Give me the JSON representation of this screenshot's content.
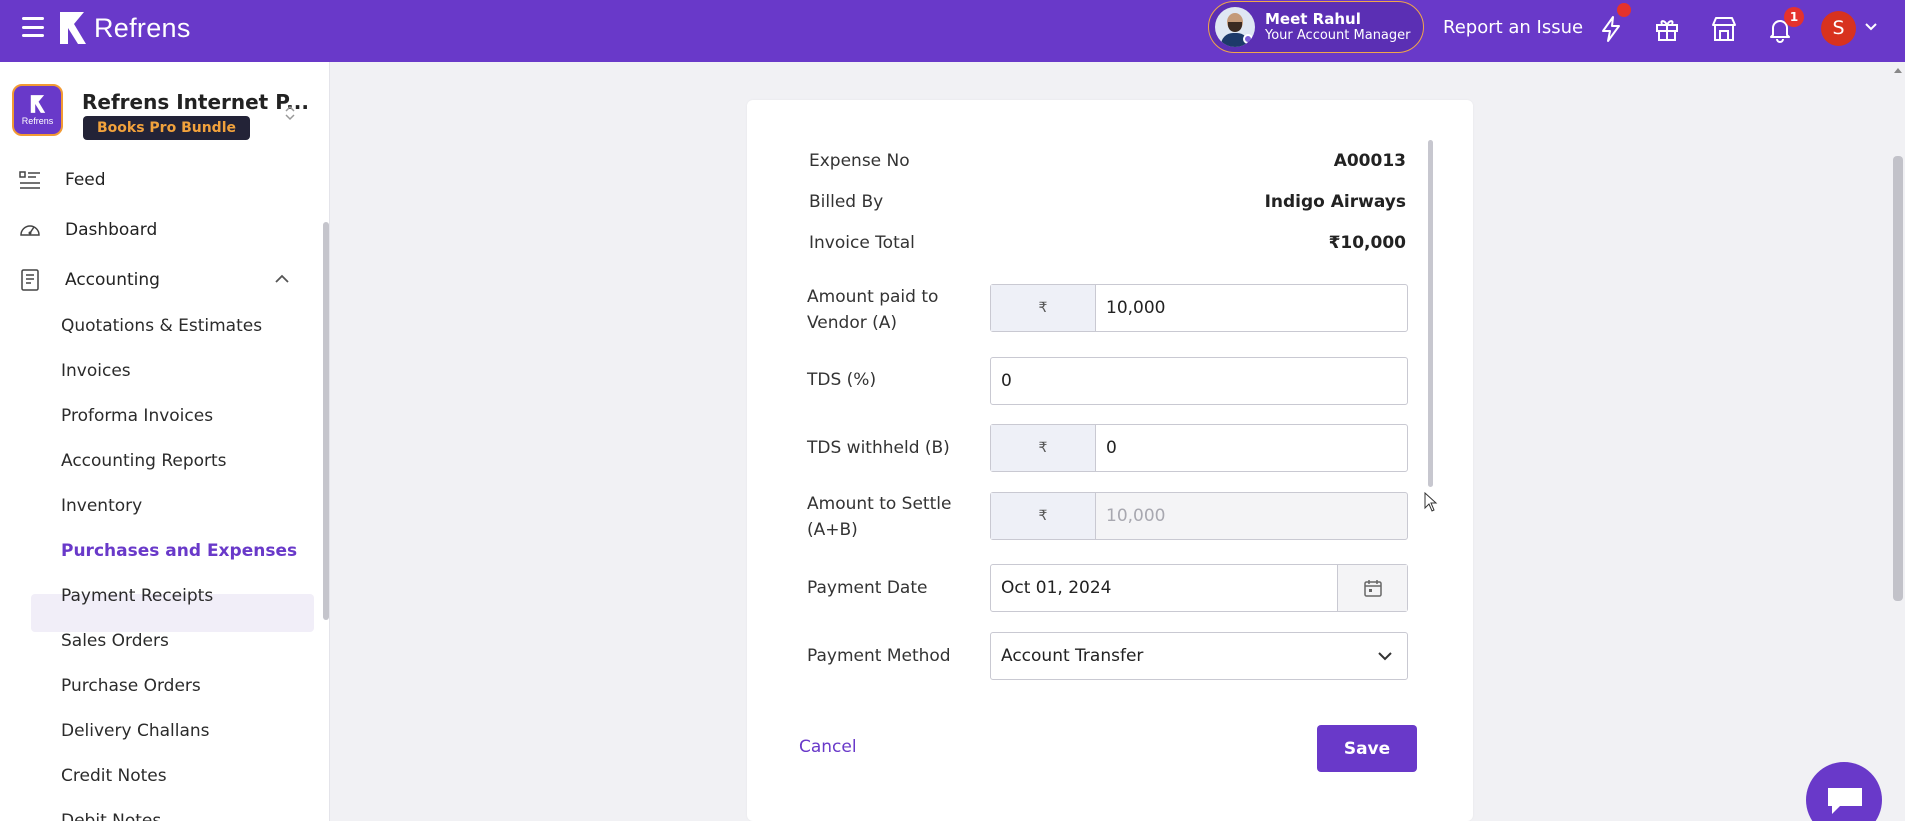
{
  "topbar": {
    "brand": "Refrens",
    "account_manager": {
      "name": "Meet Rahul",
      "role": "Your Account Manager"
    },
    "report_issue": "Report an Issue",
    "notification_count": "1",
    "user_initial": "S"
  },
  "sidebar": {
    "org": {
      "logo_text": "Refrens",
      "name": "Refrens Internet P...",
      "plan": "Books Pro Bundle"
    },
    "top_items": [
      {
        "label": "Feed",
        "icon": "feed-list-icon"
      },
      {
        "label": "Dashboard",
        "icon": "speedometer-icon"
      },
      {
        "label": "Accounting",
        "icon": "ledger-icon"
      }
    ],
    "sub_items": [
      {
        "label": "Quotations & Estimates"
      },
      {
        "label": "Invoices"
      },
      {
        "label": "Proforma Invoices"
      },
      {
        "label": "Accounting Reports"
      },
      {
        "label": "Inventory"
      },
      {
        "label": "Purchases and Expenses",
        "active": true
      },
      {
        "label": "Payment Receipts"
      },
      {
        "label": "Sales Orders"
      },
      {
        "label": "Purchase Orders"
      },
      {
        "label": "Delivery Challans"
      },
      {
        "label": "Credit Notes"
      },
      {
        "label": "Debit Notes"
      }
    ]
  },
  "form": {
    "info": [
      {
        "label": "Expense No",
        "value": "A00013"
      },
      {
        "label": "Billed By",
        "value": "Indigo Airways"
      },
      {
        "label": "Invoice Total",
        "value": "₹10,000"
      }
    ],
    "amount_paid": {
      "label_line1": "Amount paid to",
      "label_line2": "Vendor (A)",
      "prefix": "₹",
      "value": "10,000"
    },
    "tds_percent": {
      "label": "TDS (%)",
      "value": "0"
    },
    "tds_withheld": {
      "label": "TDS withheld (B)",
      "prefix": "₹",
      "value": "0"
    },
    "amount_settle": {
      "label_line1": "Amount to Settle",
      "label_line2": "(A+B)",
      "prefix": "₹",
      "value": "10,000"
    },
    "payment_date": {
      "label": "Payment Date",
      "value": "Oct 01, 2024"
    },
    "payment_method": {
      "label": "Payment Method",
      "value": "Account Transfer"
    },
    "cancel_label": "Cancel",
    "save_label": "Save"
  },
  "colors": {
    "brand": "#6939c9",
    "accent_orange": "#f2a23c",
    "alert_red": "#e5322d"
  }
}
